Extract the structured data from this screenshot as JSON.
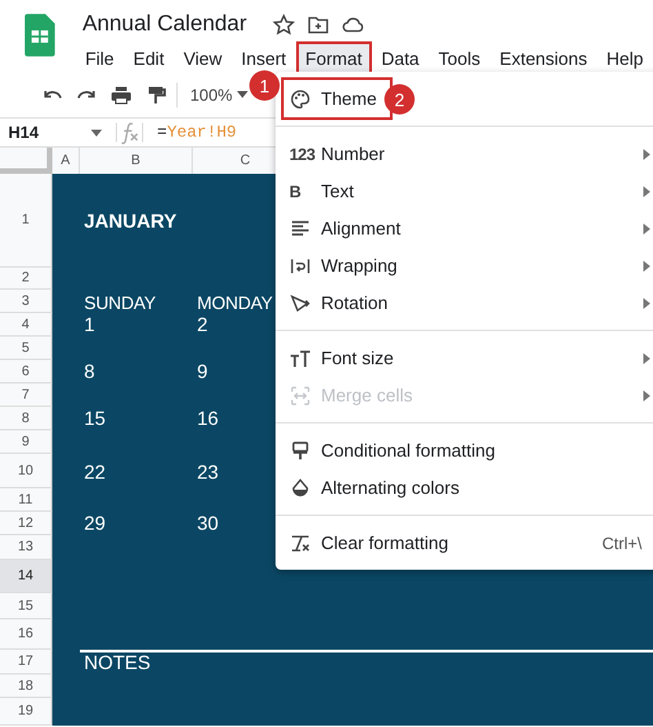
{
  "document": {
    "title": "Annual Calendar"
  },
  "menubar": [
    {
      "label": "File",
      "selected": false,
      "boxed": false
    },
    {
      "label": "Edit",
      "selected": false,
      "boxed": false
    },
    {
      "label": "View",
      "selected": false,
      "boxed": false
    },
    {
      "label": "Insert",
      "selected": false,
      "boxed": false
    },
    {
      "label": "Format",
      "selected": true,
      "boxed": true
    },
    {
      "label": "Data",
      "selected": false,
      "boxed": false
    },
    {
      "label": "Tools",
      "selected": false,
      "boxed": false
    },
    {
      "label": "Extensions",
      "selected": false,
      "boxed": false
    },
    {
      "label": "Help",
      "selected": false,
      "boxed": false
    }
  ],
  "toolbar": {
    "zoom": "100%"
  },
  "formula_bar": {
    "cell_ref": "H14",
    "sign": "=",
    "reference": "Year!H9"
  },
  "columns": [
    "A",
    "B",
    "C"
  ],
  "rows": [
    {
      "number": "1",
      "kind": "month",
      "b": "JANUARY",
      "selected": false
    },
    {
      "number": "2",
      "selected": false
    },
    {
      "number": "3",
      "kind": "weekday",
      "b": "SUNDAY",
      "c": "MONDAY",
      "selected": false
    },
    {
      "number": "4",
      "kind": "date",
      "b": "1",
      "c": "2",
      "selected": false
    },
    {
      "number": "5",
      "selected": false
    },
    {
      "number": "6",
      "kind": "date",
      "b": "8",
      "c": "9",
      "selected": false
    },
    {
      "number": "7",
      "selected": false
    },
    {
      "number": "8",
      "kind": "date",
      "b": "15",
      "c": "16",
      "selected": false
    },
    {
      "number": "9",
      "selected": false
    },
    {
      "number": "10",
      "kind": "date",
      "b": "22",
      "c": "23",
      "selected": false
    },
    {
      "number": "11",
      "selected": false
    },
    {
      "number": "12",
      "kind": "date",
      "b": "29",
      "c": "30",
      "selected": false
    },
    {
      "number": "13",
      "selected": false
    },
    {
      "number": "14",
      "selected": true
    },
    {
      "number": "15",
      "selected": false
    },
    {
      "number": "16",
      "selected": false
    },
    {
      "number": "17",
      "kind": "notes",
      "b": "NOTES",
      "selected": false
    },
    {
      "number": "18",
      "selected": false
    },
    {
      "number": "19",
      "selected": false
    }
  ],
  "format_menu": [
    [
      {
        "label": "Theme",
        "submenu": false,
        "disabled": false,
        "boxed": true
      }
    ],
    [
      {
        "label": "Number",
        "icon_text": "123",
        "submenu": true,
        "disabled": false,
        "boxed": false
      },
      {
        "label": "Text",
        "icon_text": "B",
        "submenu": true,
        "disabled": false,
        "boxed": false
      },
      {
        "label": "Alignment",
        "submenu": true,
        "disabled": false,
        "boxed": false
      },
      {
        "label": "Wrapping",
        "submenu": true,
        "disabled": false,
        "boxed": false
      },
      {
        "label": "Rotation",
        "submenu": true,
        "disabled": false,
        "boxed": false
      }
    ],
    [
      {
        "label": "Font size",
        "submenu": true,
        "disabled": false,
        "boxed": false
      },
      {
        "label": "Merge cells",
        "submenu": true,
        "disabled": true,
        "boxed": false
      }
    ],
    [
      {
        "label": "Conditional formatting",
        "submenu": false,
        "disabled": false,
        "boxed": false
      },
      {
        "label": "Alternating colors",
        "submenu": false,
        "disabled": false,
        "boxed": false
      }
    ],
    [
      {
        "label": "Clear formatting",
        "shortcut": "Ctrl+\\",
        "submenu": false,
        "disabled": false,
        "boxed": false
      }
    ]
  ],
  "callouts": [
    {
      "label": "1"
    },
    {
      "label": "2"
    }
  ]
}
